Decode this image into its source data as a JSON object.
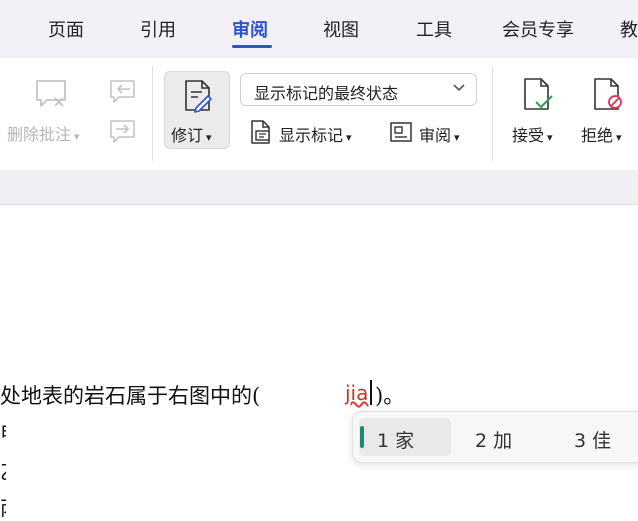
{
  "tabs": [
    "页面",
    "引用",
    "审阅",
    "视图",
    "工具",
    "会员专享",
    "教"
  ],
  "active_tab": "审阅",
  "colors": {
    "accent": "#2b55c8",
    "ime_green": "#1e8a72",
    "reject_red": "#d9364a",
    "accept_green": "#2e9e4f"
  },
  "ribbon": {
    "delete_comment": "删除批注",
    "revise": "修订",
    "markup_dropdown": "显示标记的最终状态",
    "show_markup": "显示标记",
    "review": "审阅",
    "accept": "接受",
    "reject": "拒绝"
  },
  "document": {
    "line1": "处地表的岩石属于右图中的(",
    "composition": "jia",
    "line1_end": ")。",
    "cut_lines": [
      "甲",
      "乙",
      "丙"
    ]
  },
  "ime": {
    "candidates": [
      "1 家",
      "2 加",
      "3 佳"
    ]
  }
}
